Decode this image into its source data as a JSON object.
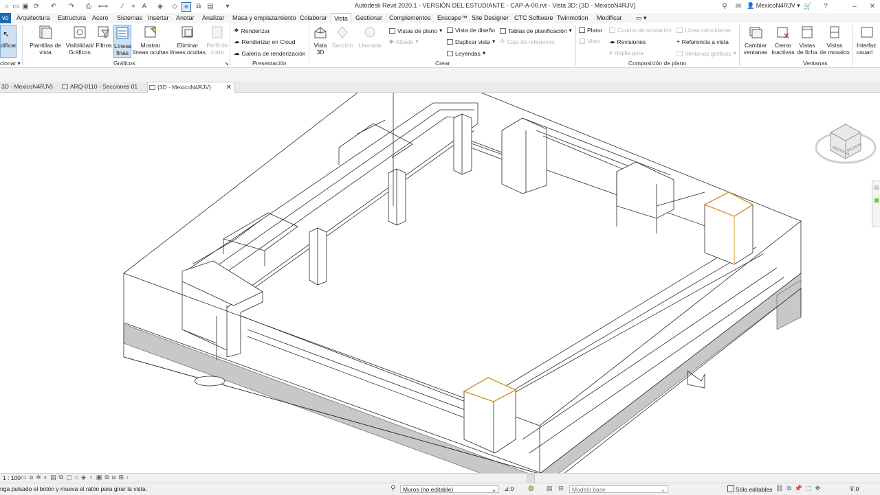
{
  "titlebar": {
    "title": "Autodesk Revit 2020.1 - VERSIÓN DEL ESTUDIANTE - CAP-A-00.rvt - Vista 3D: {3D - MexicoN4RJV}",
    "user": "MexicoN4RJV"
  },
  "menu_tabs": [
    {
      "label": "vo"
    },
    {
      "label": "Arquitectura"
    },
    {
      "label": "Estructura"
    },
    {
      "label": "Acero"
    },
    {
      "label": "Sistemas"
    },
    {
      "label": "Insertar"
    },
    {
      "label": "Anotar"
    },
    {
      "label": "Analizar"
    },
    {
      "label": "Masa y emplazamiento"
    },
    {
      "label": "Colaborar"
    },
    {
      "label": "Vista"
    },
    {
      "label": "Gestionar"
    },
    {
      "label": "Complementos"
    },
    {
      "label": "Enscape™"
    },
    {
      "label": "Site Designer"
    },
    {
      "label": "CTC Software"
    },
    {
      "label": "Twinmotion"
    },
    {
      "label": "Modificar"
    }
  ],
  "ribbon": {
    "modificar": "dificar",
    "seleccionar": "cionar",
    "graficos": {
      "plantillas": [
        "Plantillas de",
        "vista"
      ],
      "visibilidad": [
        "Visibilidad/",
        "Gráficos"
      ],
      "filtros": "Filtros",
      "lineas_finas": [
        "Líneas",
        "finas"
      ],
      "mostrar": [
        "Mostrar",
        "líneas ocultas"
      ],
      "eliminar": [
        "Eliminar",
        "líneas ocultas"
      ],
      "perfil": [
        "Perfil de",
        "corte"
      ],
      "panel": "Gráficos"
    },
    "presentacion": {
      "renderizar": "Renderizar",
      "renderizar_cloud": "Renderizar  en Cloud",
      "galeria": "Galería de  renderización",
      "panel": "Presentación"
    },
    "crear": {
      "vista3d": [
        "Vista",
        "3D"
      ],
      "seccion": "Sección",
      "llamada": "Llamada",
      "vistas_plano": "Vistas de plano",
      "alzado": "Alzado",
      "vista_diseno": "Vista de diseño",
      "duplicar": "Duplicar vista",
      "leyendas": "Leyendas",
      "tablas": "Tablas de planificación",
      "caja": "Caja de referencia",
      "panel": "Crear"
    },
    "composicion": {
      "plano": "Plano",
      "vista": "Vista",
      "cuadro": "Cuadro de rotulación",
      "revisiones": "Revisiones",
      "rejilla": "Rejilla guía",
      "lineas_coinc": "Línea coincidente",
      "referencia": "Referencia a vista",
      "ventanas_graf": "Ventanas gráficas",
      "panel": "Composición de plano"
    },
    "ventanas": {
      "cambiar": [
        "Cambiar",
        "ventanas"
      ],
      "cerrar": [
        "Cerrar",
        "inactivas"
      ],
      "ficha": [
        "Vistas",
        "de ficha"
      ],
      "mosaico": [
        "Vistas",
        "de mosaico"
      ],
      "panel": "Ventanas"
    },
    "interfaz": [
      "Interfaz",
      "usuari"
    ]
  },
  "view_tabs": [
    {
      "label": "3D - MexicoN4RJV}"
    },
    {
      "label": "ARQ-0110 - Secciones 01"
    },
    {
      "label": "{3D - MexicoN4RJV}"
    }
  ],
  "viewcube": {
    "left": "IZQUIERDA",
    "front": "DELANTE"
  },
  "viewbar": {
    "scale": "1 : 100"
  },
  "statusbar": {
    "hint": "nga pulsado el botón y mueva el ratón para girar la vista.",
    "workset": "Muros (no editable)",
    "count": ":0",
    "design_option": "Modelo base",
    "editable_only": "Sólo editables",
    "filter_count": ":0"
  },
  "colors": {
    "file_tab": "#1d6bb0",
    "accent_blue": "#2a6fb5",
    "selection_orange": "#d9902a",
    "slab_gray": "#c8c8c8"
  }
}
